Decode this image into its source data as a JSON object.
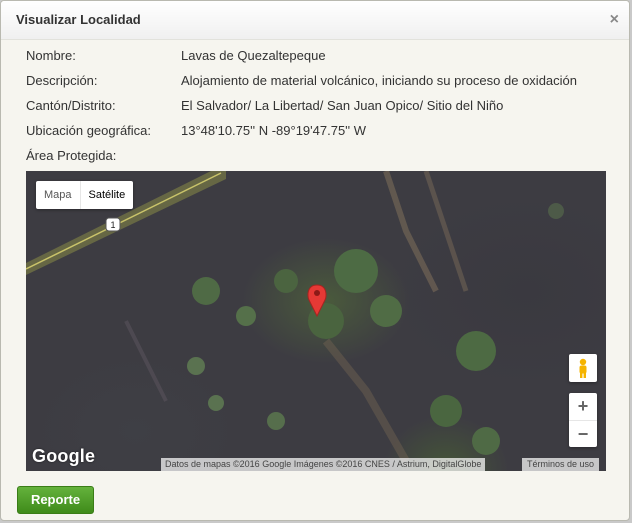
{
  "dialog": {
    "title": "Visualizar Localidad",
    "close_glyph": "×"
  },
  "fields": [
    {
      "label": "Nombre:",
      "value": "Lavas de Quezaltepeque"
    },
    {
      "label": "Descripción:",
      "value": "Alojamiento de material volcánico, iniciando su proceso de oxidación"
    },
    {
      "label": "Cantón/Distrito:",
      "value": "El Salvador/ La Libertad/ San Juan Opico/ Sitio del Niño"
    },
    {
      "label": "Ubicación geográfica:",
      "value": "13°48'10.75'' N -89°19'47.75'' W"
    },
    {
      "label": "Área Protegida:",
      "value": ""
    }
  ],
  "map": {
    "type_options": [
      "Mapa",
      "Satélite"
    ],
    "selected_type": "Satélite",
    "road_shield": "1",
    "logo_text": "Google",
    "attribution": "Datos de mapas ©2016 Google Imágenes ©2016 CNES / Astrium, DigitalGlobe",
    "terms": "Términos de uso",
    "zoom_in": "+",
    "zoom_out": "−",
    "marker_color": "#e53935"
  },
  "footer": {
    "report_label": "Reporte"
  }
}
